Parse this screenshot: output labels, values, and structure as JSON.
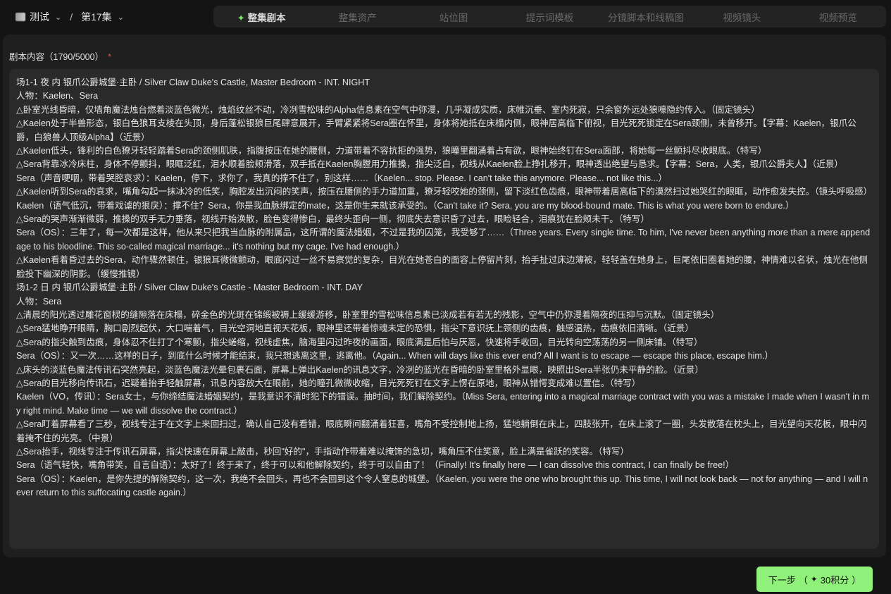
{
  "breadcrumb": {
    "project": "测试",
    "separator": "/",
    "episode": "第17集"
  },
  "tabs": [
    {
      "label": "整集剧本",
      "active": true,
      "icon": "sparkle-icon"
    },
    {
      "label": "整集资产",
      "active": false
    },
    {
      "label": "站位图",
      "active": false
    },
    {
      "label": "提示词模板",
      "active": false
    },
    {
      "label": "分镜脚本和线稿图",
      "active": false
    },
    {
      "label": "视频镜头",
      "active": false
    },
    {
      "label": "视频预览",
      "active": false
    }
  ],
  "field": {
    "label": "剧本内容（1790/5000）",
    "required_mark": "*"
  },
  "script_lines": [
    "场1-1 夜 内 银爪公爵城堡·主卧 / Silver Claw Duke's Castle, Master Bedroom - INT. NIGHT",
    "人物：Kaelen、Sera",
    "△卧室光线昏暗，仅墙角魔法烛台燃着淡蓝色微光，烛焰纹丝不动，冷冽雪松味的Alpha信息素在空气中弥漫，几乎凝成实质，床帷沉垂、室内死寂，只余窗外远处狼嚎隐约传入。（固定镜头）",
    "△Kaelen处于半兽形态，银白色狼耳支棱在头顶，身后蓬松银狼巨尾肆意展开，手臂紧紧将Sera圈在怀里，身体将她抵在床榻内侧，眼神居高临下俯视，目光死死锁定在Sera颈侧，未曾移开。【字幕：Kaelen，银爪公爵，白狼兽人顶级Alpha】（近景）",
    "△Kaelen低头，锋利的白色獠牙轻轻踏着Sera的颈侧肌肤，指腹按压在她的腰侧，力道带着不容抗拒的强势，狼瞳里翻涌着占有欲，眼神始终钉在Sera面部，将她每一丝颤抖尽收眼底。（特写）",
    "△Sera背靠冰冷床柱，身体不停颤抖，眼眶泛红，泪水顺着脸颊滑落，双手抵在Kaelen胸膛用力推搡，指尖泛白，视线从Kaelen脸上挣扎移开，眼神透出绝望与恳求。【字幕：Sera，人类，银爪公爵夫人】（近景）",
    "Sera（声音哽咽，带着哭腔哀求）：Kaelen，停下，求你了，我真的撑不住了，别这样……（Kaelen... stop. Please. I can't take this anymore. Please... not like this...）",
    "△Kaelen听到Sera的哀求，嘴角勾起一抹冰冷的低笑，胸腔发出沉闷的笑声，按压在腰侧的手力道加重，獠牙轻咬她的颈侧，留下淡红色齿痕，眼神带着居高临下的漠然扫过她哭红的眼眶，动作愈发失控。（镜头呼吸感）",
    "Kaelen（语气低沉，带着戏谑的狠戾）：撑不住？Sera，你是我血脉绑定的mate，这是你生来就该承受的。（Can't take it? Sera, you are my blood-bound mate. This is what you were born to endure.）",
    "△Sera的哭声渐渐微弱，推搡的双手无力垂落，视线开始涣散，脸色变得惨白，最终头歪向一侧，彻底失去意识昏了过去，眼睑轻合，泪痕犹在脸颊未干。（特写）",
    "Sera（OS）：三年了，每一次都是这样，他从来只把我当血脉的附属品，这所谓的魔法婚姻，不过是我的囚笼，我受够了……（Three years. Every single time. To him, I've never been anything more than a mere appendage to his bloodline. This so-called magical marriage... it's nothing but my cage. I've had enough.）",
    "△Kaelen看着昏过去的Sera，动作骤然顿住，银狼耳微微颤动，眼底闪过一丝不易察觉的复杂，目光在她苍白的面容上停留片刻，抬手扯过床边薄被，轻轻盖在她身上，巨尾依旧圈着她的腰，神情难以名状，烛光在他侧脸投下幽深的阴影。（缓慢推镜）",
    "场1-2 日 内 银爪公爵城堡·主卧 / Silver Claw Duke's Castle - Master Bedroom - INT. DAY",
    "人物：Sera",
    "△清晨的阳光透过雕花窗棂的缝隙落在床榻，碎金色的光斑在锦缎被褥上缓缓游移，卧室里的雪松味信息素已淡成若有若无的残影，空气中仍弥漫着隔夜的压抑与沉默。（固定镜头）",
    "△Sera猛地睁开眼睛，胸口剧烈起伏，大口喘着气，目光空洞地直视天花板，眼神里还带着惊魂未定的恐惧，指尖下意识抚上颈侧的齿痕，触感温热，齿痕依旧清晰。（近景）",
    "△Sera的指尖触到齿痕，身体忍不住打了个寒颤，指尖蜷缩，视线虚焦，脑海里闪过昨夜的画面，眼底满是后怕与厌恶，快速将手收回，目光转向空荡荡的另一侧床铺。（特写）",
    "Sera（OS）：又一次……这样的日子，到底什么时候才能结束，我只想逃离这里，逃离他。（Again... When will days like this ever end? All I want is to escape — escape this place, escape him.）",
    "△床头的淡蓝色魔法传讯石突然亮起，淡蓝色魔法光晕包裹石面，屏幕上弹出Kaelen的讯息文字，冷冽的蓝光在昏暗的卧室里格外显眼，映照出Sera半张仍未平静的脸。（近景）",
    "△Sera的目光移向传讯石，迟疑着抬手轻触屏幕，讯息内容放大在眼前，她的瞳孔微微收缩，目光死死钉在文字上愣在原地，眼神从错愕变成难以置信。（特写）",
    "Kaelen（VO，传讯）：Sera女士，与你缔结魔法婚姻契约，是我意识不清时犯下的错误。抽时间，我们解除契约。（Miss Sera, entering into a magical marriage contract with you was a mistake I made when I wasn't in my right mind. Make time — we will dissolve the contract.）",
    "△Sera盯着屏幕看了三秒，视线专注于在文字上来回扫过，确认自己没有看错，眼底瞬间翻涌着狂喜，嘴角不受控制地上扬，猛地躺倒在床上，四肢张开，在床上滚了一圈，头发散落在枕头上，目光望向天花板，眼中闪着掩不住的光亮。（中景）",
    "△Sera抬手，视线专注于传讯石屏幕，指尖快速在屏幕上敲击，秒回\"好的\"，手指动作带着难以掩饰的急切，嘴角压不住笑意，脸上满是雀跃的笑容。（特写）",
    "Sera（语气轻快，嘴角带笑，自言自语）：太好了！终于来了，终于可以和他解除契约，终于可以自由了！（Finally! It's finally here — I can dissolve this contract, I can finally be free!）",
    "Sera（OS）：Kaelen，是你先提的解除契约，这一次，我绝不会回头，再也不会回到这个令人窒息的城堡。（Kaelen, you were the one who brought this up. This time, I will not look back — not for anything — and I will never return to this suffocating castle again.）"
  ],
  "next_button": {
    "label": "下一步",
    "cost": "30积分",
    "icon": "sparkle-icon"
  },
  "colors": {
    "accent": "#8ff07a",
    "background": "#141414",
    "panel": "#1f1f1f",
    "input": "#2a2a2a"
  }
}
